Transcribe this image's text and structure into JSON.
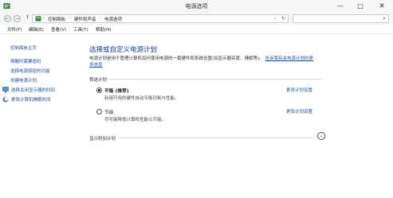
{
  "window": {
    "title": "电源选项",
    "controls": {
      "minimize": "—",
      "maximize": "□",
      "close": "✕"
    }
  },
  "navigation": {
    "back": "←",
    "forward": "→",
    "up": "↑",
    "breadcrumb": [
      "控制面板",
      "硬件和声音",
      "电源选项"
    ],
    "separator": "›",
    "dropdown": "⌄",
    "refresh": "↻",
    "search_placeholder": "",
    "search_icon": "⌕"
  },
  "menu": {
    "items": [
      "文件(F)",
      "编辑(E)",
      "查看(V)",
      "工具(T)",
      "帮助(H)"
    ]
  },
  "sidebar": {
    "items": [
      {
        "label": "控制面板主页"
      },
      {
        "label": "唤醒时需要密码"
      },
      {
        "label": "选择电源按钮的功能"
      },
      {
        "label": "创建电源计划"
      },
      {
        "label": "选择关闭显示器的时间",
        "icon": "display-power-icon"
      },
      {
        "label": "更改计算机睡眠时间",
        "icon": "sleep-icon"
      }
    ]
  },
  "main": {
    "title": "选择或自定义电源计划",
    "description": "电源计划是用于管理计算机如何使用电源的一套硬件和系统设置(如显示器亮度、睡眠等)。",
    "description_link": "告诉我有关电源计划的更多信息",
    "preferred_section": "首选计划",
    "plans": [
      {
        "name": "平衡 (推荐)",
        "description": "利用可用的硬件自动平衡功耗与性能。",
        "link": "更改计划设置",
        "selected": true
      },
      {
        "name": "节能",
        "description": "尽可能降低计算机性能以节能。",
        "link": "更改计划设置",
        "selected": false
      }
    ],
    "more_plans": "显示附加计划",
    "expand_icon": "⌄"
  },
  "colors": {
    "link": "#1f4fa0",
    "title": "#1a3e8a",
    "chrome": "#f5f6f7"
  }
}
